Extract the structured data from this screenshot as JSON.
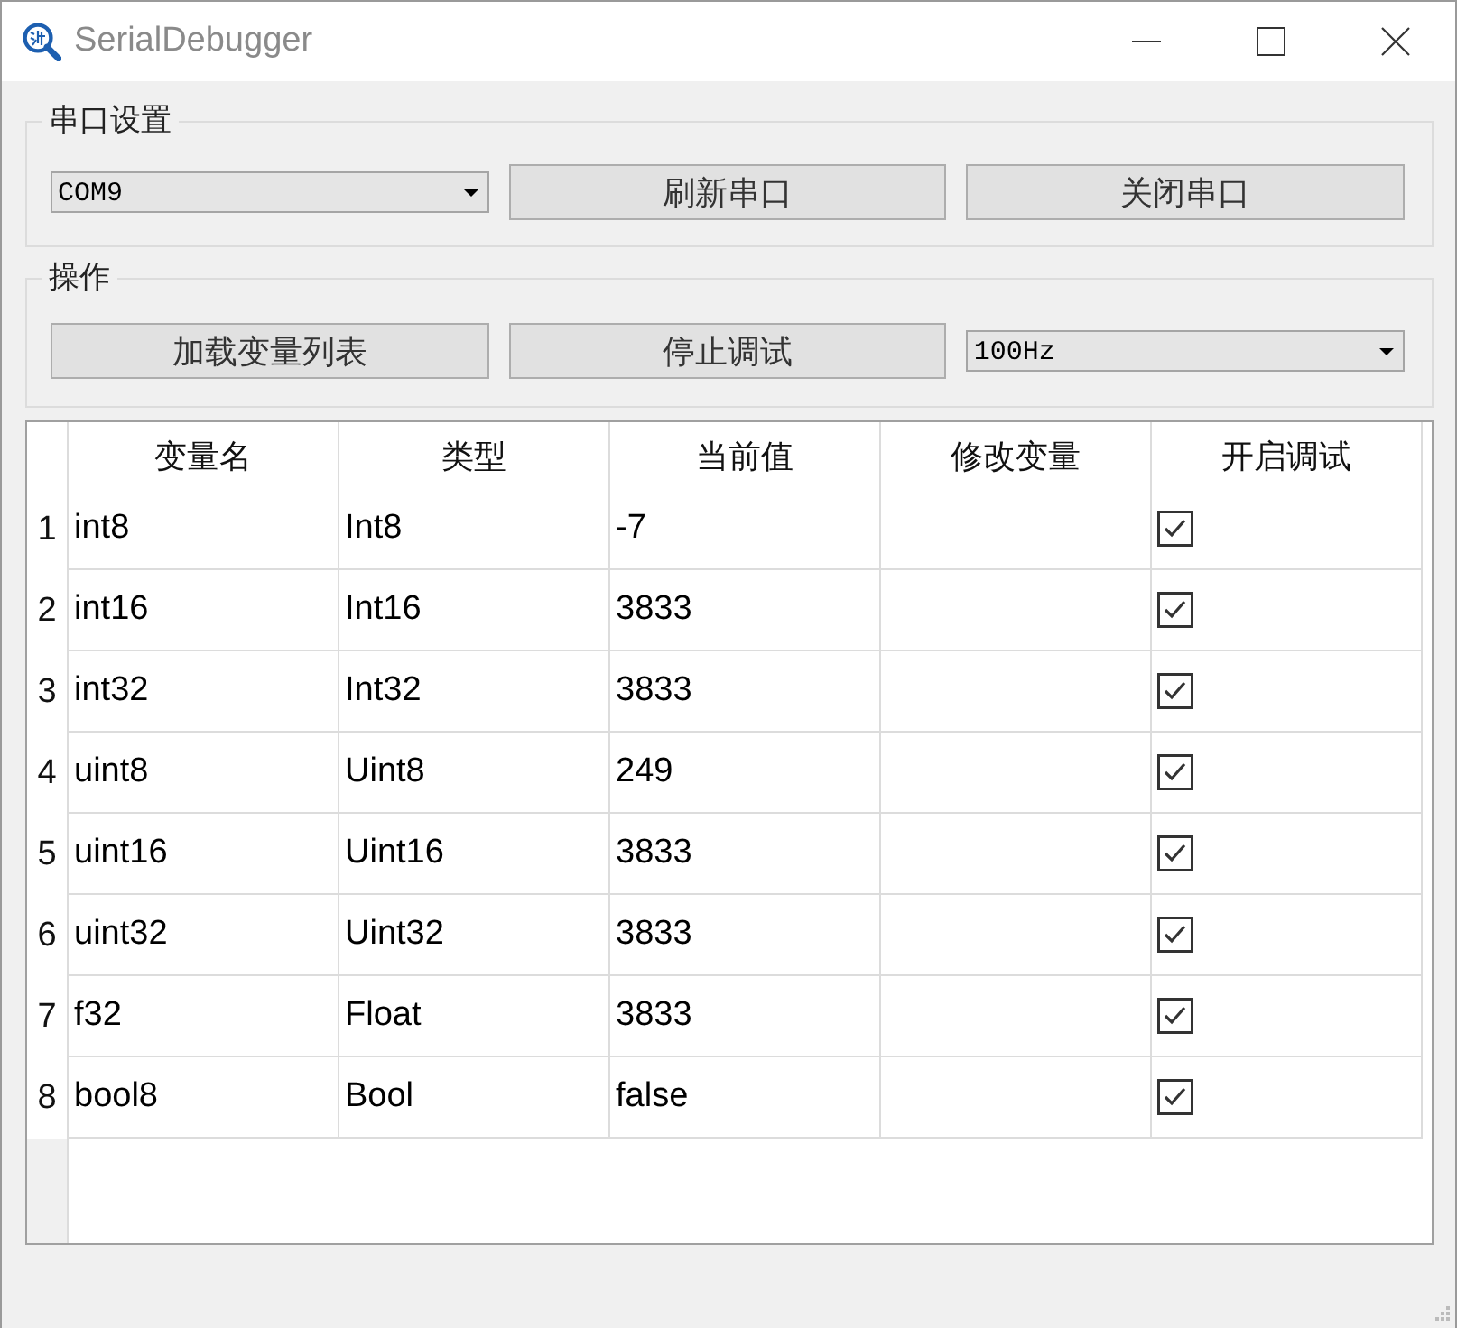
{
  "window": {
    "title": "SerialDebugger"
  },
  "port_settings": {
    "title": "串口设置",
    "port": "COM9",
    "buttons": [
      "刷新串口",
      "关闭串口"
    ]
  },
  "operations": {
    "title": "操作",
    "buttons": [
      "加载变量列表",
      "停止调试"
    ],
    "rate": "100Hz"
  },
  "table": {
    "columns": [
      "变量名",
      "类型",
      "当前值",
      "修改变量",
      "开启调试"
    ],
    "rows": [
      {
        "number": "1",
        "name": "int8",
        "type": "Int8",
        "value": "-7",
        "checked": true
      },
      {
        "number": "2",
        "name": "int16",
        "type": "Int16",
        "value": "3833",
        "checked": true
      },
      {
        "number": "3",
        "name": "int32",
        "type": "Int32",
        "value": "3833",
        "checked": true
      },
      {
        "number": "4",
        "name": "uint8",
        "type": "Uint8",
        "value": "249",
        "checked": true
      },
      {
        "number": "5",
        "name": "uint16",
        "type": "Uint16",
        "value": "3833",
        "checked": true
      },
      {
        "number": "6",
        "name": "uint32",
        "type": "Uint32",
        "value": "3833",
        "checked": true
      },
      {
        "number": "7",
        "name": "f32",
        "type": "Float",
        "value": "3833",
        "checked": true
      },
      {
        "number": "8",
        "name": "bool8",
        "type": "Bool",
        "value": "false",
        "checked": true
      }
    ]
  }
}
